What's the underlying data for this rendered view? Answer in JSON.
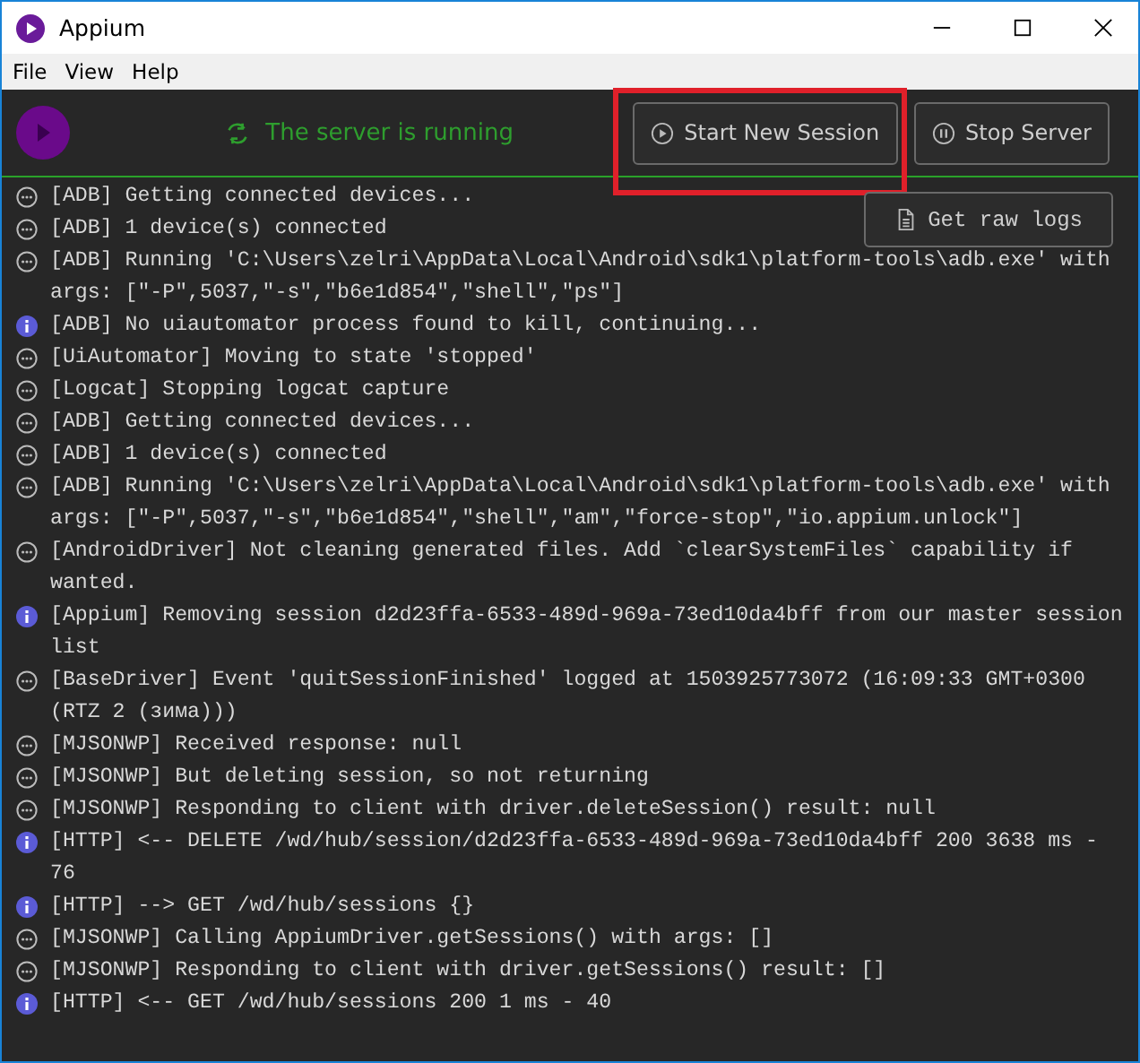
{
  "window": {
    "title": "Appium"
  },
  "menu": [
    {
      "label": "File"
    },
    {
      "label": "View"
    },
    {
      "label": "Help"
    }
  ],
  "server_status": "The server is running",
  "buttons": [
    {
      "label": "Start New Session",
      "kind": "play",
      "highlighted": true
    },
    {
      "label": "Stop Server",
      "kind": "pause",
      "highlighted": false
    }
  ],
  "raw_logs_button": "Get raw logs",
  "logs": [
    {
      "kind": "debug",
      "text": "[ADB] Getting connected devices..."
    },
    {
      "kind": "debug",
      "text": "[ADB] 1 device(s) connected"
    },
    {
      "kind": "debug",
      "text": "[ADB] Running 'C:\\Users\\zelri\\AppData\\Local\\Android\\sdk1\\platform-tools\\adb.exe' with args: [\"-P\",5037,\"-s\",\"b6e1d854\",\"shell\",\"ps\"]"
    },
    {
      "kind": "info",
      "text": "[ADB] No uiautomator process found to kill, continuing..."
    },
    {
      "kind": "debug",
      "text": "[UiAutomator] Moving to state 'stopped'"
    },
    {
      "kind": "debug",
      "text": "[Logcat] Stopping logcat capture"
    },
    {
      "kind": "debug",
      "text": "[ADB] Getting connected devices..."
    },
    {
      "kind": "debug",
      "text": "[ADB] 1 device(s) connected"
    },
    {
      "kind": "debug",
      "text": "[ADB] Running 'C:\\Users\\zelri\\AppData\\Local\\Android\\sdk1\\platform-tools\\adb.exe' with args: [\"-P\",5037,\"-s\",\"b6e1d854\",\"shell\",\"am\",\"force-stop\",\"io.appium.unlock\"]"
    },
    {
      "kind": "debug",
      "text": "[AndroidDriver] Not cleaning generated files. Add `clearSystemFiles` capability if wanted."
    },
    {
      "kind": "info",
      "text": "[Appium] Removing session d2d23ffa-6533-489d-969a-73ed10da4bff from our master session list"
    },
    {
      "kind": "debug",
      "text": "[BaseDriver] Event 'quitSessionFinished' logged at 1503925773072 (16:09:33 GMT+0300 (RTZ 2 (зима)))"
    },
    {
      "kind": "debug",
      "text": "[MJSONWP] Received response: null"
    },
    {
      "kind": "debug",
      "text": "[MJSONWP] But deleting session, so not returning"
    },
    {
      "kind": "debug",
      "text": "[MJSONWP] Responding to client with driver.deleteSession() result: null"
    },
    {
      "kind": "info",
      "text": "[HTTP] <-- DELETE /wd/hub/session/d2d23ffa-6533-489d-969a-73ed10da4bff 200 3638 ms - 76"
    },
    {
      "kind": "info",
      "text": "[HTTP] --> GET /wd/hub/sessions {}"
    },
    {
      "kind": "debug",
      "text": "[MJSONWP] Calling AppiumDriver.getSessions() with args: []"
    },
    {
      "kind": "debug",
      "text": "[MJSONWP] Responding to client with driver.getSessions() result: []"
    },
    {
      "kind": "info",
      "text": "[HTTP] <-- GET /wd/hub/sessions 200 1 ms - 40"
    }
  ]
}
